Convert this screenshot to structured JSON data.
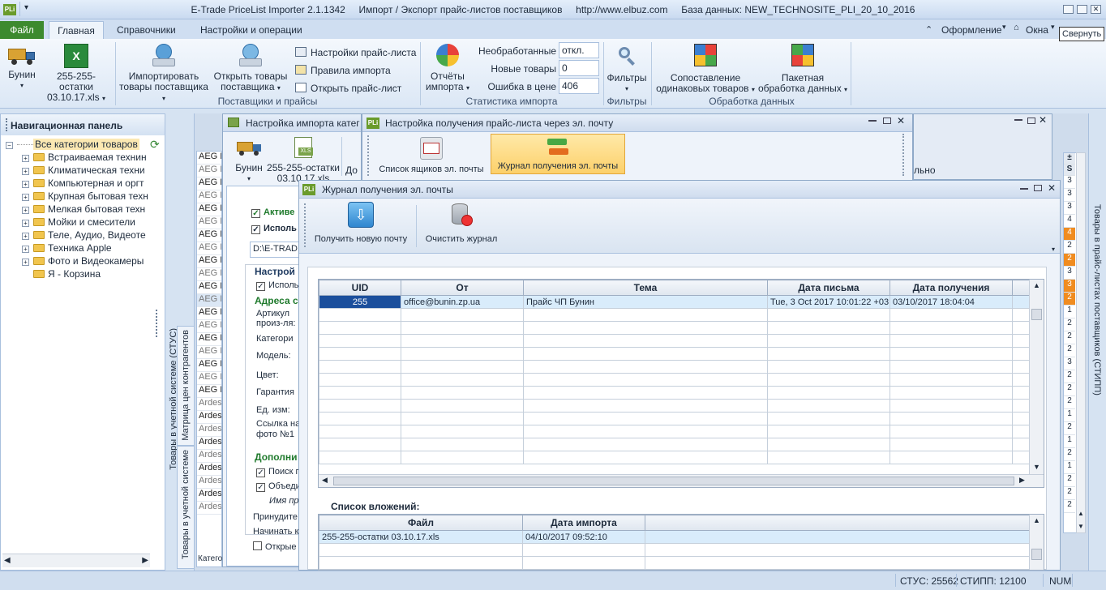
{
  "app": {
    "logo": "PLi",
    "title_line": "E-Trade PriceList Importer 2.1.1342     Импорт / Экспорт прайс-листов поставщиков     http://www.elbuz.com     База данных: NEW_TECHNOSITE_PLI_20_10_2016"
  },
  "tabs": [
    "Файл",
    "Главная",
    "Справочники",
    "Настройки и операции"
  ],
  "ribbon_right": {
    "design": "Оформление",
    "window": "Окна",
    "collapse": "Свернуть"
  },
  "ribbon": {
    "supplier_btn": "Бунин",
    "file_btn_1": "255-255-остатки",
    "file_btn_2": "03.10.17.xls",
    "import_btn_1": "Импортировать",
    "import_btn_2": "товары поставщика",
    "open_goods_1": "Открыть товары",
    "open_goods_2": "поставщика",
    "small_1": "Настройки прайс-листа",
    "small_2": "Правила импорта",
    "small_3": "Открыть прайс-лист",
    "group_suppliers": "Поставщики и прайсы",
    "reports_1": "Отчёты",
    "reports_2": "импорта",
    "stat_labels": [
      "Необработанные",
      "Новые товары",
      "Ошибка в цене"
    ],
    "stat_values": [
      "откл.",
      "0",
      "406"
    ],
    "group_stats": "Статистика импорта",
    "filters_btn": "Фильтры",
    "group_filters": "Фильтры",
    "compare_1": "Сопоставление",
    "compare_2": "одинаковых товаров",
    "batch_1": "Пакетная",
    "batch_2": "обработка данных",
    "group_processing": "Обработка данных"
  },
  "nav": {
    "title": "Навигационная панель",
    "root": "Все категории товаров",
    "items": [
      "Встраиваемая технин",
      "Климатическая техни",
      "Компьютерная и оргт",
      "Крупная бытовая техн",
      "Мелкая бытовая техн",
      "Мойки и смесители",
      "Теле, Аудио, Видеоте",
      "Техника Apple",
      "Фото и Видеокамеры",
      "Я - Корзина"
    ]
  },
  "side_tabs": {
    "a": "Товары в учетной системе (СТУС)",
    "b": "Матрица цен контрагентов",
    "c": "Товары в учетной системе",
    "right": "Товары в прайс-листах поставщиков (СТИПП)"
  },
  "bg_grid": {
    "rows": [
      "AEG H",
      "AEG H",
      "AEG H",
      "AEG H",
      "AEG H",
      "AEG H",
      "AEG H",
      "AEG H",
      "AEG H",
      "AEG H",
      "AEG H",
      "AEG H",
      "AEG H",
      "AEG H",
      "AEG H",
      "AEG H",
      "AEG H",
      "AEG H",
      "AEG H",
      "Ardes",
      "Ardes",
      "Ardes",
      "Ardes",
      "Ardes",
      "Ardes",
      "Ardes",
      "Ardes",
      "Ardes"
    ],
    "footer": "Катего"
  },
  "import_win": {
    "title": "Настройка импорта катег",
    "supplier": "Бунин",
    "file_1": "255-255-остатки",
    "file_2": "03.10.17.xls",
    "extra": "До",
    "active": "Активе",
    "use": "Исполь",
    "path": "D:\\E-TRAD",
    "settings": "Настрой",
    "use2": "Исполь",
    "addresses": "Адреса с",
    "fields": [
      "Артикул произ-ля:",
      "Категори",
      "Модель:",
      "Цвет:",
      "Гарантия",
      "Ед. изм:",
      "Ссылка на фото №1"
    ],
    "additional": "Дополни",
    "search": "Поиск п",
    "merge": "Объеди",
    "name_hint": "Имя пр",
    "force": "Принудите",
    "begin": "Начинать к",
    "open": "Открые"
  },
  "email_win": {
    "title": "Настройка получения прайс-листа через эл. почту",
    "btn_list": "Список ящиков эл. почты",
    "btn_journal": "Журнал получения эл. почты",
    "right_frag": "льно"
  },
  "journal_win": {
    "title": "Журнал получения эл. почты",
    "btn_get": "Получить новую почту",
    "btn_clear": "Очистить журнал",
    "columns": [
      "UID",
      "От",
      "Тема",
      "Дата письма",
      "Дата получения"
    ],
    "rows": [
      [
        "255",
        "office@bunin.zp.ua",
        "Прайс ЧП Бунин",
        "Tue, 3 Oct 2017 10:01:22 +03",
        "03/10/2017 18:04:04"
      ]
    ],
    "attachments_label": "Список вложений:",
    "att_columns": [
      "Файл",
      "Дата импорта"
    ],
    "att_rows": [
      [
        "255-255-остатки 03.10.17.xls",
        "04/10/2017 09:52:10"
      ]
    ]
  },
  "right_col": {
    "header": [
      "±",
      "S"
    ],
    "values": [
      "3",
      "3",
      "3",
      "4",
      "4",
      "2",
      "2",
      "3",
      "3",
      "2",
      "1",
      "2",
      "2",
      "2",
      "3",
      "2",
      "2",
      "2",
      "1",
      "2",
      "1",
      "2",
      "1",
      "2",
      "2",
      "2"
    ],
    "orange_idx": [
      4,
      6,
      8,
      9
    ]
  },
  "status": {
    "stus": "СТУС: 25562",
    "stipp": "СТИПП: 12100",
    "num": "NUM"
  },
  "colors": {
    "accent": "#3d8a2e",
    "selection": "#1b4f9c",
    "highlight_btn": "#fcd77a",
    "orange": "#f08c20"
  }
}
